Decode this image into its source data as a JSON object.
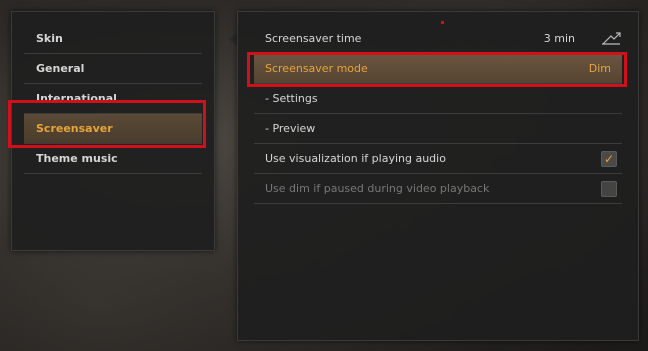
{
  "nav": {
    "items": [
      {
        "label": "Skin"
      },
      {
        "label": "General"
      },
      {
        "label": "International"
      },
      {
        "label": "Screensaver",
        "active": true
      },
      {
        "label": "Theme music"
      }
    ]
  },
  "settings": {
    "screensaver_time": {
      "label": "Screensaver time",
      "value": "3 min"
    },
    "screensaver_mode": {
      "label": "Screensaver mode",
      "value": "Dim"
    },
    "settings_link": {
      "label": "- Settings"
    },
    "preview_link": {
      "label": "- Preview"
    },
    "use_visualization": {
      "label": "Use visualization if playing audio",
      "checked": true
    },
    "use_dim": {
      "label": "Use dim if paused during video playback",
      "checked": false,
      "disabled": true
    }
  },
  "colors": {
    "accent": "#e8a33a",
    "highlight_box": "#d0101a"
  }
}
